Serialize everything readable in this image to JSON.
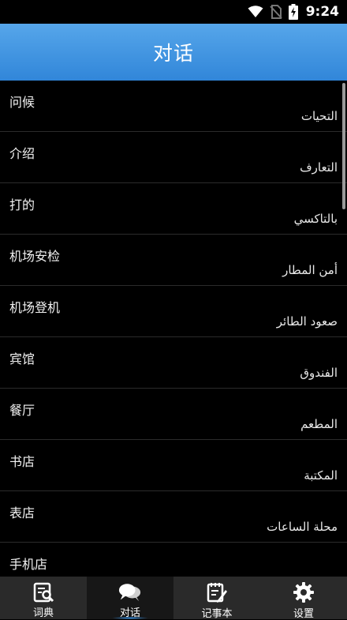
{
  "status_bar": {
    "time": "9:24",
    "icons": [
      "wifi-icon",
      "no-sim-icon",
      "battery-charging-icon"
    ]
  },
  "header": {
    "title": "对话"
  },
  "list": {
    "items": [
      {
        "zh": "问候",
        "ar": "التحيات"
      },
      {
        "zh": "介绍",
        "ar": "التعارف"
      },
      {
        "zh": "打的",
        "ar": "بالتاكسي"
      },
      {
        "zh": "机场安检",
        "ar": "أمن المطار"
      },
      {
        "zh": "机场登机",
        "ar": "صعود الطائر"
      },
      {
        "zh": "宾馆",
        "ar": "الفندوق"
      },
      {
        "zh": "餐厅",
        "ar": "المطعم"
      },
      {
        "zh": "书店",
        "ar": "المكتبة"
      },
      {
        "zh": "表店",
        "ar": "محلة الساعات"
      },
      {
        "zh": "手机店",
        "ar": ""
      }
    ]
  },
  "tabs": [
    {
      "label": "词典",
      "icon": "dictionary-icon",
      "active": false
    },
    {
      "label": "对话",
      "icon": "chat-bubbles-icon",
      "active": true
    },
    {
      "label": "记事本",
      "icon": "notepad-icon",
      "active": false
    },
    {
      "label": "设置",
      "icon": "gear-icon",
      "active": false
    }
  ],
  "colors": {
    "header_gradient_top": "#56a6ea",
    "header_gradient_bottom": "#3186d9",
    "background": "#000000",
    "tabbar": "#2a2a2a",
    "active_tab": "#171717",
    "active_indicator": "#3aa0ff"
  }
}
